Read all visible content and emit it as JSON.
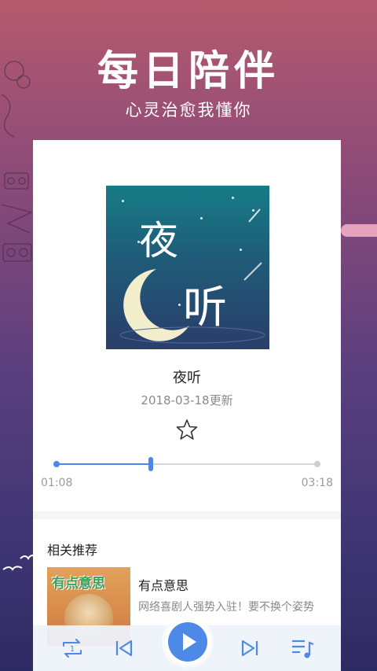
{
  "header": {
    "title": "每日陪伴",
    "subtitle": "心灵治愈我懂你"
  },
  "player": {
    "cover_title_chars": [
      "夜",
      "听"
    ],
    "track_title": "夜听",
    "update_date": "2018-03-18更新",
    "favorite_icon": "star-outline-icon",
    "current_time": "01:08",
    "total_time": "03:18",
    "progress": 0.36,
    "accent_color": "#4c86e6"
  },
  "recommendations": {
    "section_title": "相关推荐",
    "items": [
      {
        "name": "有点意思",
        "description": "网络喜剧人强势入驻！要不换个姿势",
        "thumb_label": "有点意思"
      }
    ]
  },
  "controls": {
    "loop_icon": "loop-one-icon",
    "loop_badge": "1",
    "prev_icon": "skip-previous-icon",
    "play_icon": "play-icon",
    "next_icon": "skip-next-icon",
    "playlist_icon": "playlist-music-icon"
  }
}
